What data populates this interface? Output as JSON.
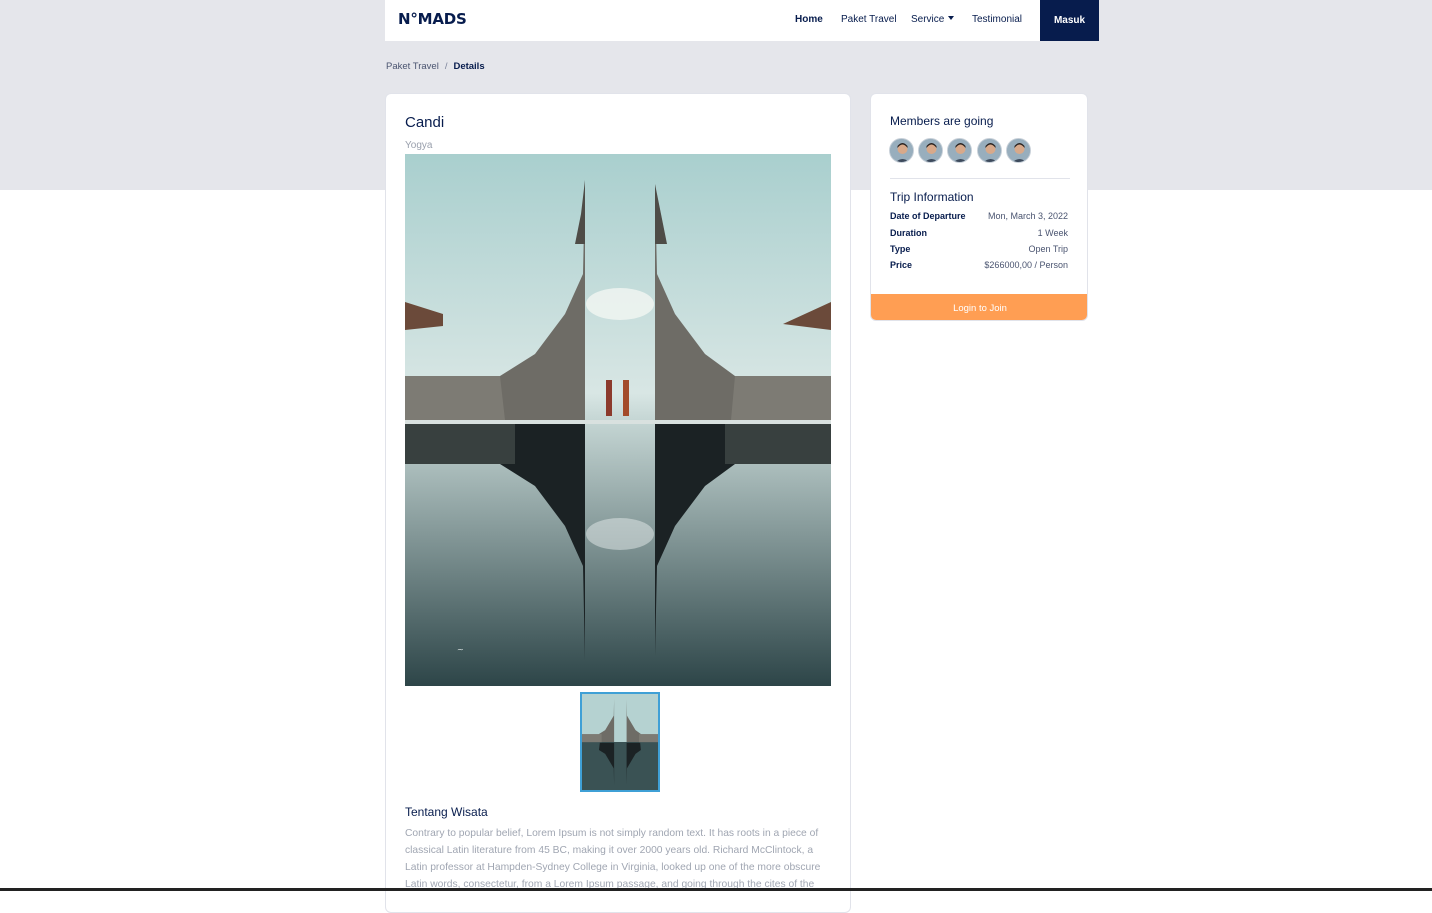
{
  "brand": {
    "logo_text": "N°MADS"
  },
  "nav": {
    "items": [
      {
        "label": "Home",
        "active": true
      },
      {
        "label": "Paket Travel",
        "active": false
      },
      {
        "label": "Service",
        "active": false,
        "dropdown": true
      },
      {
        "label": "Testimonial",
        "active": false
      }
    ],
    "login_button": "Masuk"
  },
  "breadcrumb": {
    "items": [
      "Paket Travel",
      "Details"
    ],
    "separator": "/"
  },
  "detail": {
    "title": "Candi",
    "location": "Yogya",
    "about_title": "Tentang Wisata",
    "about_text": "Contrary to popular belief, Lorem Ipsum is not simply random text. It has roots in a piece of classical Latin literature from 45 BC, making it over 2000 years old. Richard McClintock, a Latin professor at Hampden-Sydney College in Virginia, looked up one of the more obscure Latin words, consectetur, from a Lorem Ipsum passage, and going through the cites of the"
  },
  "sidebar": {
    "members_title": "Members are going",
    "member_count": 5,
    "trip_title": "Trip Information",
    "trip_rows": [
      {
        "label": "Date of Departure",
        "value": "Mon, March 3, 2022"
      },
      {
        "label": "Duration",
        "value": "1 Week"
      },
      {
        "label": "Type",
        "value": "Open Trip"
      },
      {
        "label": "Price",
        "value": "$266000,00 / Person"
      }
    ],
    "join_button": "Login to Join"
  },
  "colors": {
    "primary": "#071c4d",
    "accent": "#ff9e53",
    "band": "#e5e6eb",
    "muted_text": "#a0a6b2"
  }
}
